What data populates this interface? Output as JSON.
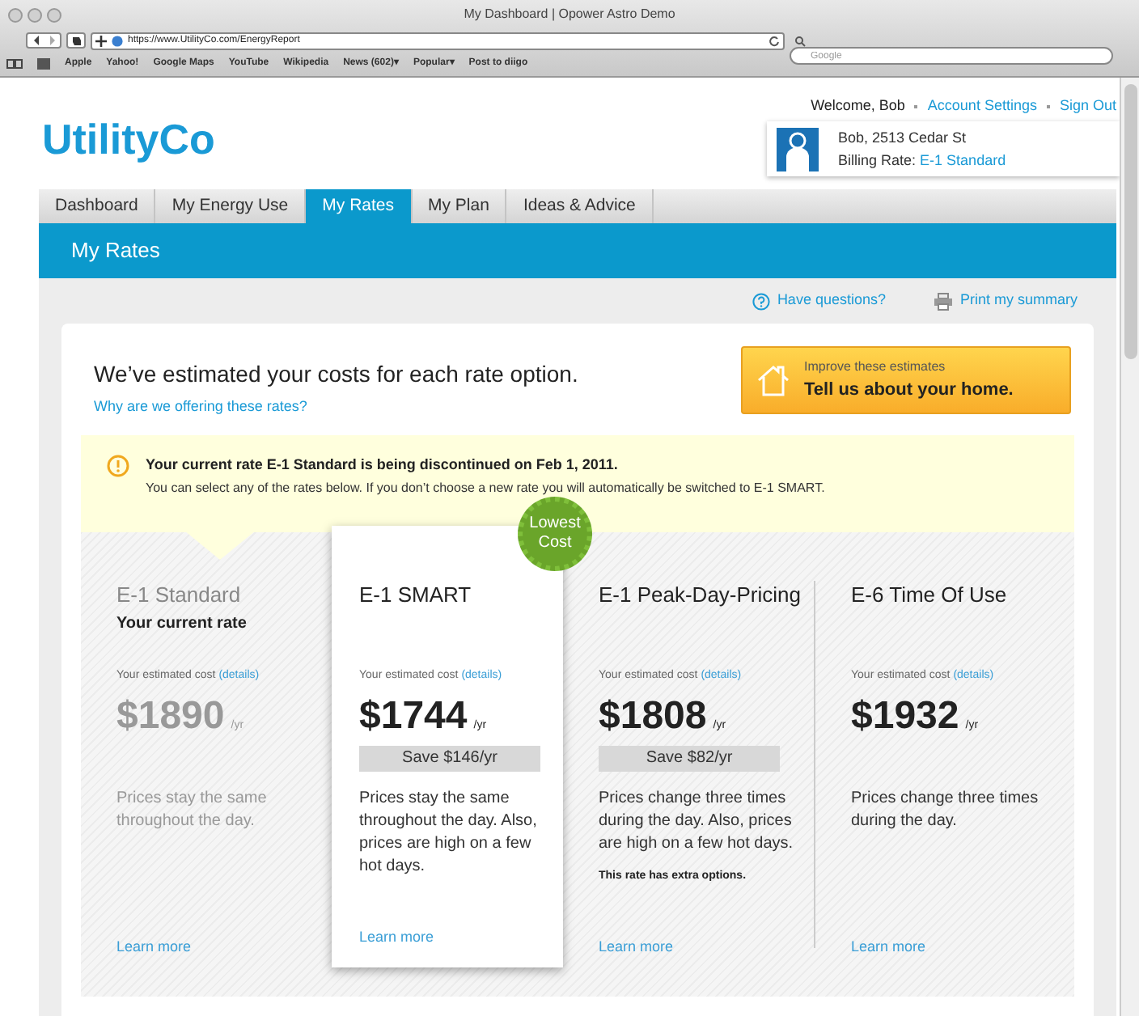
{
  "browser": {
    "title": "My Dashboard | Opower Astro Demo",
    "url": "https://www.UtilityCo.com/EnergyReport",
    "search": {
      "placeholder": "Google"
    },
    "bookmarks": [
      "Apple",
      "Yahoo!",
      "Google Maps",
      "YouTube",
      "Wikipedia",
      "News (602)▾",
      "Popular▾",
      "Post to diigo"
    ]
  },
  "header": {
    "logo": "UtilityCo",
    "welcome": "Welcome, Bob",
    "links": [
      "Account Settings",
      "Sign Out"
    ],
    "account": {
      "name": "Bob, 2513 Cedar St",
      "rate_label": "Billing Rate:",
      "rate": "E-1 Standard"
    }
  },
  "tabs": [
    {
      "label": "Dashboard",
      "selected": false
    },
    {
      "label": "My Energy Use",
      "selected": false
    },
    {
      "label": "My Rates",
      "selected": true
    },
    {
      "label": "My Plan",
      "selected": false
    },
    {
      "label": "Ideas & Advice",
      "selected": false
    }
  ],
  "page_title": "My Rates",
  "help_links": [
    "Have questions?",
    "Print my summary"
  ],
  "intro": {
    "heading": "We’ve estimated your costs for each rate option.",
    "link": "Why are we offering these rates?"
  },
  "improve": {
    "label": "Improve these estimates",
    "action": "Tell us about your home."
  },
  "notice": {
    "title": "Your current rate E-1 Standard is being discontinued on Feb 1, 2011.",
    "body": "You can select any of the rates below. If you don’t choose a new rate you will automatically be switched to E-1 SMART."
  },
  "rates": [
    {
      "name": "E-1 Standard",
      "current": true,
      "highlighted": false,
      "note": "Your current rate",
      "estimate_label": "Your estimated cost",
      "details": "(details)",
      "price": "$1890",
      "unit": "/yr",
      "description": "Prices stay the same throughout the day.",
      "learn_more": "Learn more"
    },
    {
      "name": "E-1 SMART",
      "current": false,
      "highlighted": true,
      "badge": "Lowest Cost",
      "estimate_label": "Your estimated cost",
      "details": "(details)",
      "price": "$1744",
      "unit": "/yr",
      "savings": "Save $146/yr",
      "description": "Prices stay the same throughout the day. Also, prices are high on a few hot days.",
      "learn_more": "Learn more"
    },
    {
      "name": "E-1 Peak-Day-Pricing",
      "current": false,
      "highlighted": false,
      "estimate_label": "Your estimated cost",
      "details": "(details)",
      "price": "$1808",
      "unit": "/yr",
      "savings": "Save $82/yr",
      "description": "Prices change three times during the day. Also, prices are high on a few hot days.",
      "extra": "This rate has extra options.",
      "learn_more": "Learn more"
    },
    {
      "name": "E-6 Time Of Use",
      "current": false,
      "highlighted": false,
      "estimate_label": "Your estimated cost",
      "details": "(details)",
      "price": "$1932",
      "unit": "/yr",
      "description": "Prices change three times during the day.",
      "learn_more": "Learn more"
    }
  ]
}
